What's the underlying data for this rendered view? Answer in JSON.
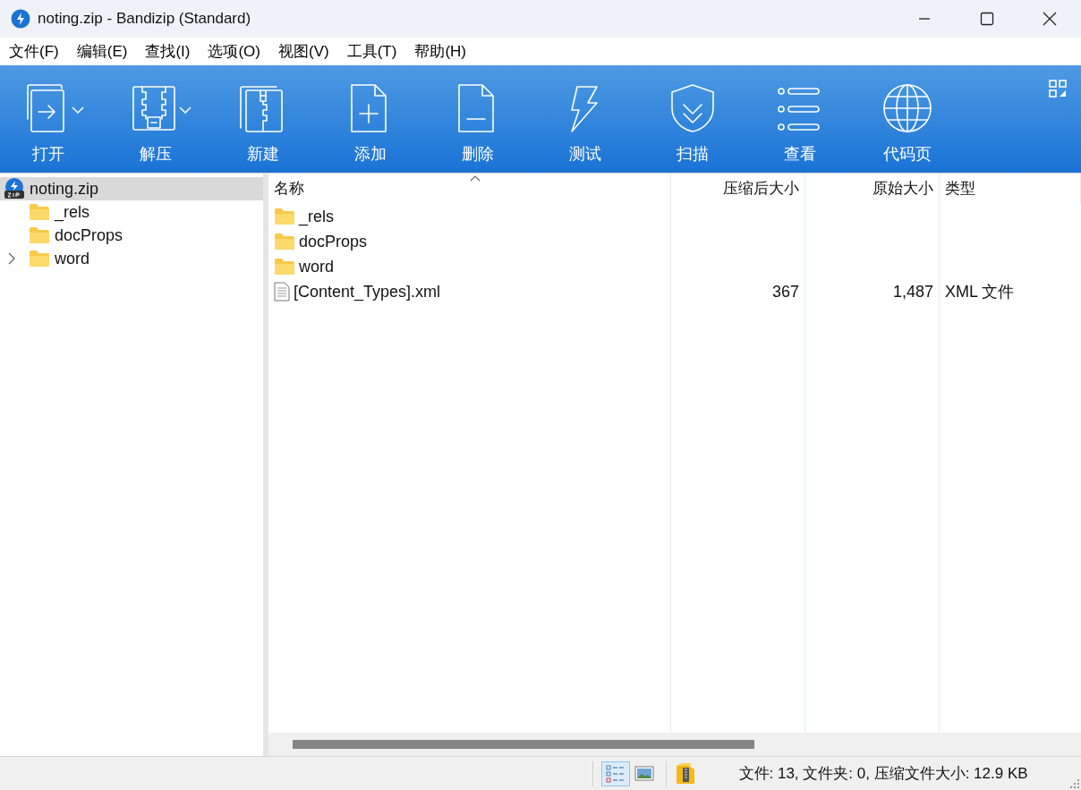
{
  "window": {
    "title": "noting.zip - Bandizip (Standard)"
  },
  "menu": [
    "文件(F)",
    "编辑(E)",
    "查找(I)",
    "选项(O)",
    "视图(V)",
    "工具(T)",
    "帮助(H)"
  ],
  "toolbar": [
    {
      "label": "打开",
      "kind": "open",
      "dropdown": true
    },
    {
      "label": "解压",
      "kind": "extract",
      "dropdown": true
    },
    {
      "label": "新建",
      "kind": "new",
      "dropdown": false
    },
    {
      "label": "添加",
      "kind": "add",
      "dropdown": false
    },
    {
      "label": "删除",
      "kind": "delete",
      "dropdown": false
    },
    {
      "label": "测试",
      "kind": "test",
      "dropdown": false
    },
    {
      "label": "扫描",
      "kind": "scan",
      "dropdown": false
    },
    {
      "label": "查看",
      "kind": "view",
      "dropdown": false
    },
    {
      "label": "代码页",
      "kind": "codepage",
      "dropdown": false
    }
  ],
  "tree": {
    "label": "noting.zip",
    "selected": true,
    "children": [
      {
        "label": "_rels",
        "expandable": false,
        "selected": false
      },
      {
        "label": "docProps",
        "expandable": false,
        "selected": false
      },
      {
        "label": "word",
        "expandable": true,
        "selected": false
      }
    ]
  },
  "table": {
    "columns": [
      {
        "label": "名称",
        "sorted": true
      },
      {
        "label": "压缩后大小",
        "sorted": false
      },
      {
        "label": "原始大小",
        "sorted": false
      },
      {
        "label": "类型",
        "sorted": false
      }
    ],
    "rows": [
      {
        "kind": "folder",
        "name": "_rels"
      },
      {
        "kind": "folder",
        "name": "docProps"
      },
      {
        "kind": "folder",
        "name": "word"
      },
      {
        "kind": "file",
        "name": "[Content_Types].xml",
        "compressed": "367",
        "original": "1,487",
        "type": "XML 文件"
      }
    ]
  },
  "status_bar": {
    "views": [
      {
        "kind": "list",
        "selected": true
      },
      {
        "kind": "thumbnail",
        "selected": false
      }
    ],
    "text": "文件: 13, 文件夹: 0, 压缩文件大小: 12.9 KB"
  }
}
